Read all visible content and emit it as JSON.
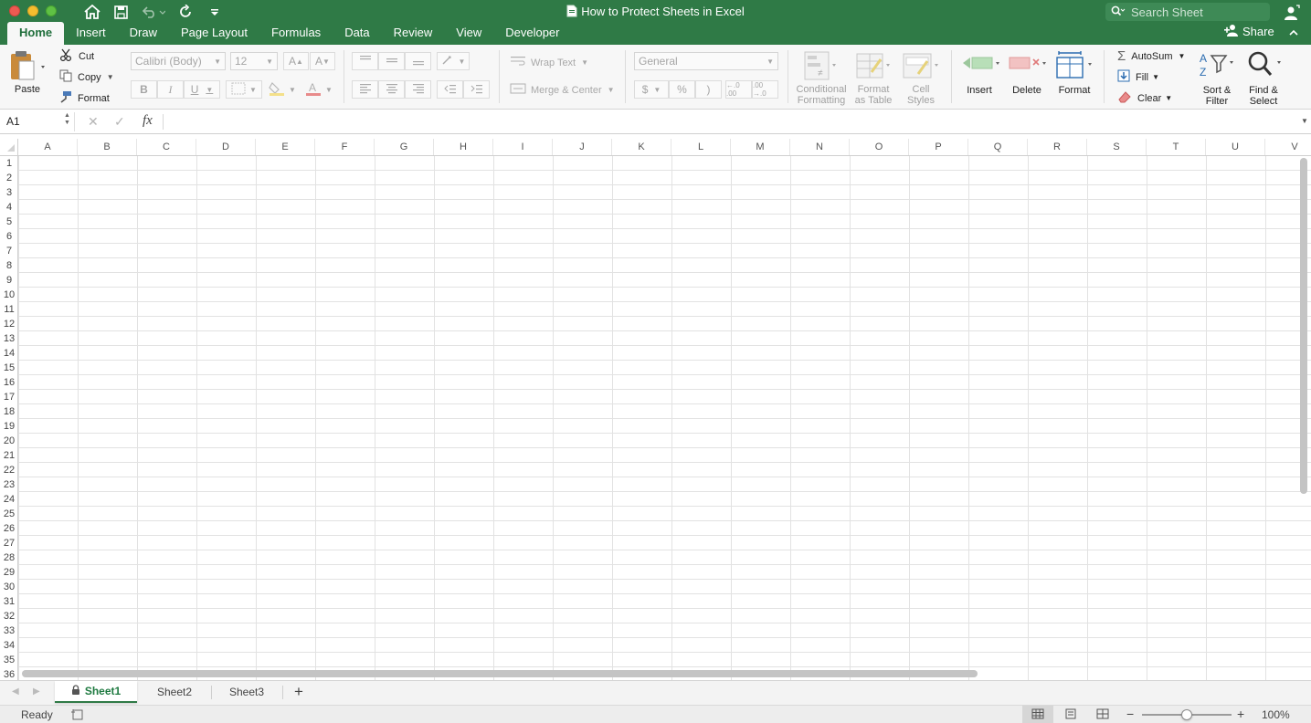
{
  "window": {
    "title": "How to Protect Sheets in Excel",
    "search_placeholder": "Search Sheet",
    "share_label": "Share"
  },
  "tabs": [
    "Home",
    "Insert",
    "Draw",
    "Page Layout",
    "Formulas",
    "Data",
    "Review",
    "View",
    "Developer"
  ],
  "ribbon": {
    "paste": "Paste",
    "cut": "Cut",
    "copy": "Copy",
    "format_painter": "Format",
    "font_name": "Calibri (Body)",
    "font_size": "12",
    "bold": "B",
    "italic": "I",
    "underline": "U",
    "wrap_text": "Wrap Text",
    "merge_center": "Merge & Center",
    "number_format": "General",
    "currency": "$",
    "percent": "%",
    "comma": ")",
    "increase_decimal": "←.0 .00",
    "decrease_decimal": ".00 →.0",
    "conditional_formatting": [
      "Conditional",
      "Formatting"
    ],
    "format_as_table": [
      "Format",
      "as Table"
    ],
    "cell_styles": [
      "Cell",
      "Styles"
    ],
    "insert": "Insert",
    "delete": "Delete",
    "format": "Format",
    "autosum": "AutoSum",
    "fill": "Fill",
    "clear": "Clear",
    "sort_filter": [
      "Sort &",
      "Filter"
    ],
    "find_select": [
      "Find &",
      "Select"
    ]
  },
  "formula_bar": {
    "name_box": "A1",
    "fx": "fx",
    "value": ""
  },
  "columns": [
    "A",
    "B",
    "C",
    "D",
    "E",
    "F",
    "G",
    "H",
    "I",
    "J",
    "K",
    "L",
    "M",
    "N",
    "O",
    "P",
    "Q",
    "R",
    "S",
    "T",
    "U",
    "V"
  ],
  "rows": [
    "1",
    "2",
    "3",
    "4",
    "5",
    "6",
    "7",
    "8",
    "9",
    "10",
    "11",
    "12",
    "13",
    "14",
    "15",
    "16",
    "17",
    "18",
    "19",
    "20",
    "21",
    "22",
    "23",
    "24",
    "25",
    "26",
    "27",
    "28",
    "29",
    "30",
    "31",
    "32",
    "33",
    "34",
    "35",
    "36"
  ],
  "sheets": [
    "Sheet1",
    "Sheet2",
    "Sheet3"
  ],
  "active_sheet": "Sheet1",
  "active_sheet_locked": true,
  "status": {
    "text": "Ready",
    "zoom": "100%",
    "zoom_level_pct": 100
  },
  "colors": {
    "brand_green": "#2f7a46",
    "active_tab_text": "#1f6e3b"
  }
}
